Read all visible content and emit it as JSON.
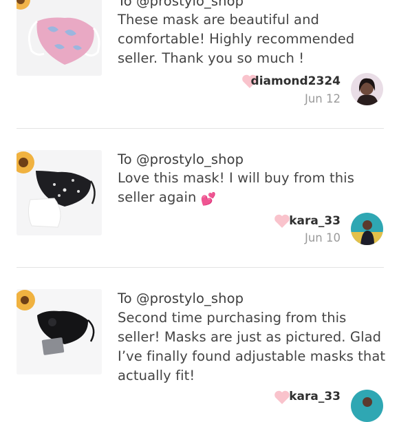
{
  "reviews": [
    {
      "to": "To @prostylo_shop",
      "text": "These mask are beautiful and comfortable! Highly recommended seller. Thank you so much !",
      "emoji": "",
      "username": "diamond2324",
      "date": "Jun 12"
    },
    {
      "to": "To @prostylo_shop",
      "text": "Love this mask! I will buy from this seller again",
      "emoji": "💕",
      "username": "kara_33",
      "date": "Jun 10"
    },
    {
      "to": "To @prostylo_shop",
      "text": "Second time purchasing from this seller! Masks are just as pictured. Glad I’ve finally found adjustable masks that actually fit!",
      "emoji": "",
      "username": "kara_33",
      "date": ""
    }
  ],
  "colors": {
    "heart": "#f9c3cc",
    "divider": "#e3e3e3",
    "date": "#9a9a9a"
  }
}
